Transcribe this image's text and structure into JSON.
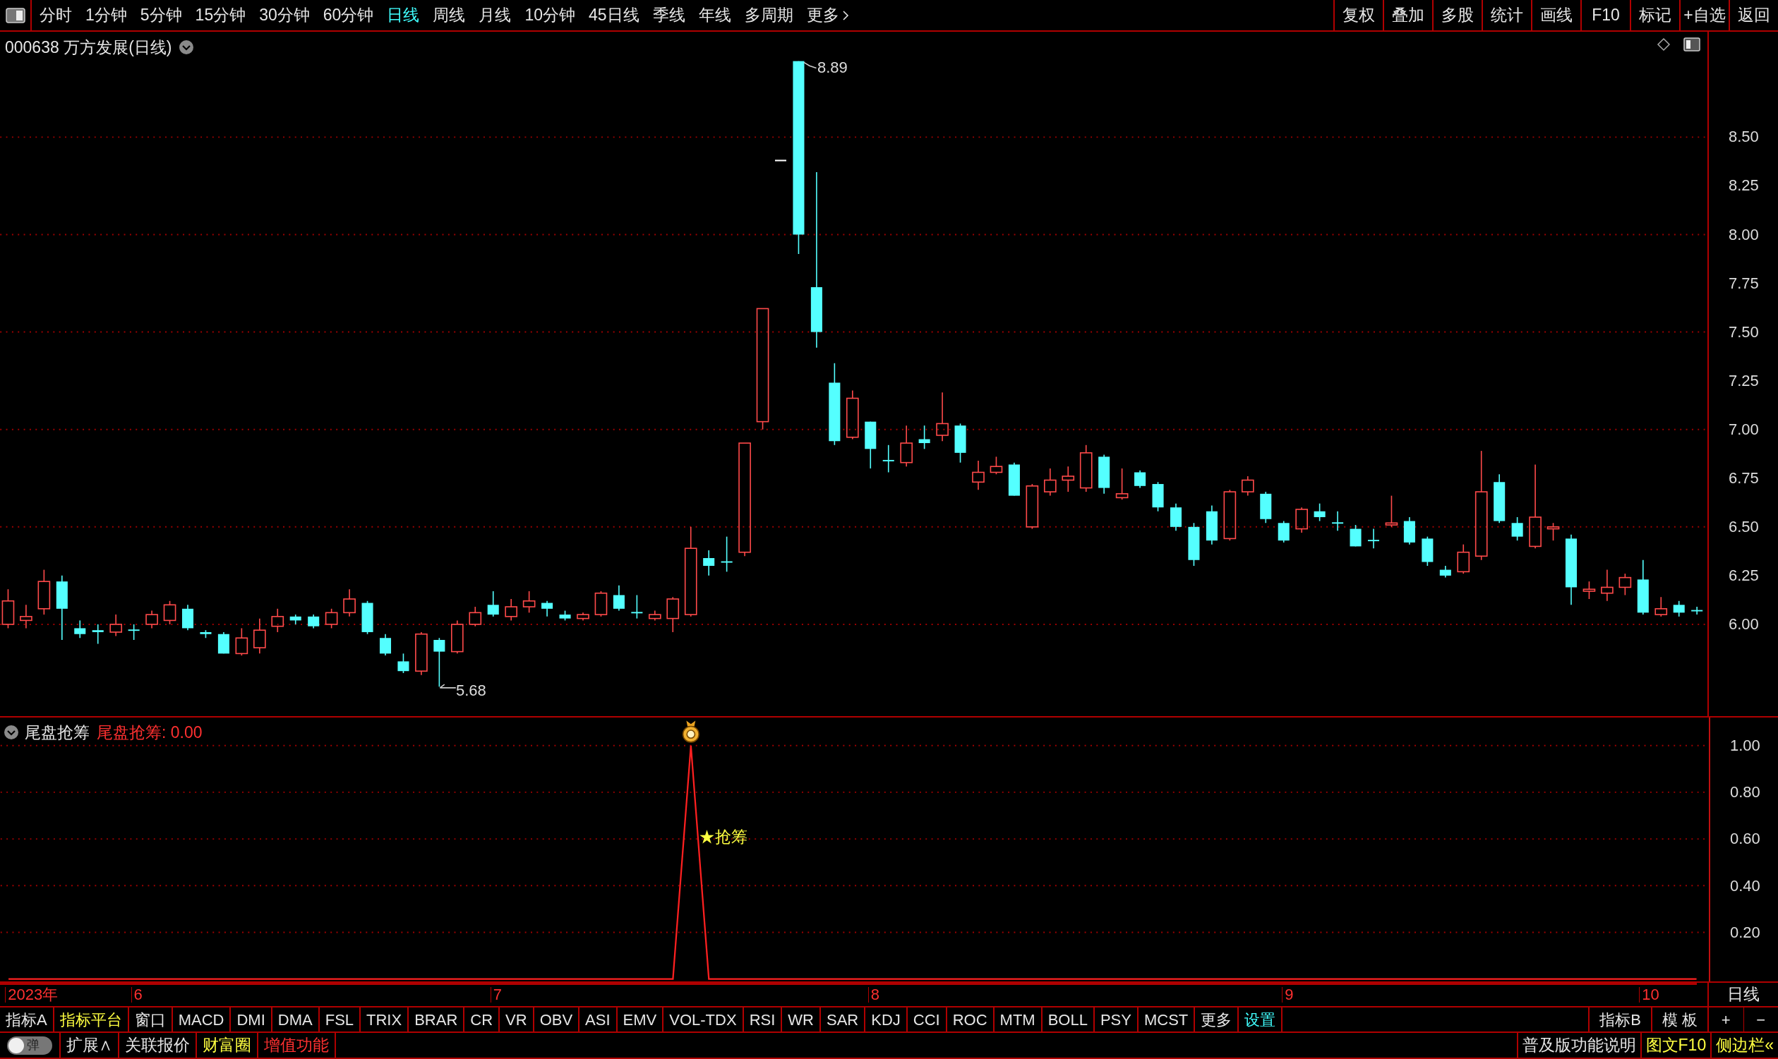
{
  "toolbar": {
    "periods": [
      {
        "label": "分时",
        "selected": false
      },
      {
        "label": "1分钟",
        "selected": false
      },
      {
        "label": "5分钟",
        "selected": false
      },
      {
        "label": "15分钟",
        "selected": false
      },
      {
        "label": "30分钟",
        "selected": false
      },
      {
        "label": "60分钟",
        "selected": false
      },
      {
        "label": "日线",
        "selected": true
      },
      {
        "label": "周线",
        "selected": false
      },
      {
        "label": "月线",
        "selected": false
      },
      {
        "label": "10分钟",
        "selected": false
      },
      {
        "label": "45日线",
        "selected": false
      },
      {
        "label": "季线",
        "selected": false
      },
      {
        "label": "年线",
        "selected": false
      },
      {
        "label": "多周期",
        "selected": false
      }
    ],
    "more": "更多",
    "tools": [
      "复权",
      "叠加",
      "多股",
      "统计",
      "画线",
      "F10",
      "标记",
      "+自选",
      "返回"
    ]
  },
  "chart_header": {
    "title": "000638 万方发展(日线)"
  },
  "price_axis": {
    "labels": [
      "8.50",
      "8.25",
      "8.00",
      "7.75",
      "7.50",
      "7.25",
      "7.00",
      "6.75",
      "6.50",
      "6.25",
      "6.00"
    ]
  },
  "high_marker": "8.89",
  "low_marker": "5.68",
  "indicator": {
    "reading": "尾盘抢筹: 0.00",
    "signal_label": "★抢筹",
    "chart_data": {
      "type": "line",
      "grid": true,
      "ylim": [
        -0.01,
        1.12
      ],
      "yticks": [
        {
          "value": 1,
          "label": "1.00"
        },
        {
          "value": 0.8,
          "label": "0.80"
        },
        {
          "value": 0.6,
          "label": "0.60"
        },
        {
          "value": 0.4,
          "label": "0.40"
        },
        {
          "value": 0.2,
          "label": "0.20"
        }
      ],
      "series": [
        {
          "name": "尾盘抢筹",
          "color": "#ff2020",
          "values": [
            0,
            0,
            0,
            0,
            0,
            0,
            0,
            0,
            0,
            0,
            0,
            0,
            0,
            0,
            0,
            0,
            0,
            0,
            0,
            0,
            0,
            0,
            0,
            0,
            0,
            0,
            0,
            0,
            0,
            0,
            0,
            0,
            0,
            0,
            0,
            0,
            0,
            0,
            1,
            0,
            0,
            0,
            0,
            0,
            0,
            0,
            0,
            0,
            0,
            0,
            0,
            0,
            0,
            0,
            0,
            0,
            0,
            0,
            0,
            0,
            0,
            0,
            0,
            0,
            0,
            0,
            0,
            0,
            0,
            0,
            0,
            0,
            0,
            0,
            0,
            0,
            0,
            0,
            0,
            0,
            0,
            0,
            0,
            0,
            0,
            0,
            0,
            0,
            0,
            0,
            0,
            0,
            0,
            0,
            0
          ]
        }
      ]
    }
  },
  "date_axis": {
    "labels": [
      "2023年",
      "6",
      "7",
      "8",
      "9",
      "10"
    ],
    "period": "日线"
  },
  "indicator_tabs": [
    {
      "label": "指标A",
      "kind": "normal"
    },
    {
      "label": "指标平台",
      "kind": "featured"
    },
    {
      "label": "窗口",
      "kind": "normal"
    },
    {
      "label": "MACD",
      "kind": "normal"
    },
    {
      "label": "DMI",
      "kind": "normal"
    },
    {
      "label": "DMA",
      "kind": "normal"
    },
    {
      "label": "FSL",
      "kind": "normal"
    },
    {
      "label": "TRIX",
      "kind": "normal"
    },
    {
      "label": "BRAR",
      "kind": "normal"
    },
    {
      "label": "CR",
      "kind": "normal"
    },
    {
      "label": "VR",
      "kind": "normal"
    },
    {
      "label": "OBV",
      "kind": "normal"
    },
    {
      "label": "ASI",
      "kind": "normal"
    },
    {
      "label": "EMV",
      "kind": "normal"
    },
    {
      "label": "VOL-TDX",
      "kind": "normal"
    },
    {
      "label": "RSI",
      "kind": "normal"
    },
    {
      "label": "WR",
      "kind": "normal"
    },
    {
      "label": "SAR",
      "kind": "normal"
    },
    {
      "label": "KDJ",
      "kind": "normal"
    },
    {
      "label": "CCI",
      "kind": "normal"
    },
    {
      "label": "ROC",
      "kind": "normal"
    },
    {
      "label": "MTM",
      "kind": "normal"
    },
    {
      "label": "BOLL",
      "kind": "normal"
    },
    {
      "label": "PSY",
      "kind": "normal"
    },
    {
      "label": "MCST",
      "kind": "normal"
    },
    {
      "label": "更多",
      "kind": "normal"
    },
    {
      "label": "设置",
      "kind": "settings"
    }
  ],
  "indicator_tabs_right": [
    "指标B",
    "模 板"
  ],
  "zoom_buttons": [
    "+",
    "−"
  ],
  "status_bar": {
    "toggle": {
      "label": "弹",
      "on": false
    },
    "left": [
      {
        "label": "扩展∧",
        "kind": "normal"
      },
      {
        "label": "关联报价",
        "kind": "normal"
      },
      {
        "label": "财富圈",
        "kind": "featured"
      },
      {
        "label": "增值功能",
        "kind": "premium"
      }
    ],
    "right": [
      {
        "label": "普及版功能说明",
        "kind": "normal"
      },
      {
        "label": "图文F10",
        "kind": "featured"
      },
      {
        "label": "侧边栏«",
        "kind": "featured"
      }
    ]
  }
}
